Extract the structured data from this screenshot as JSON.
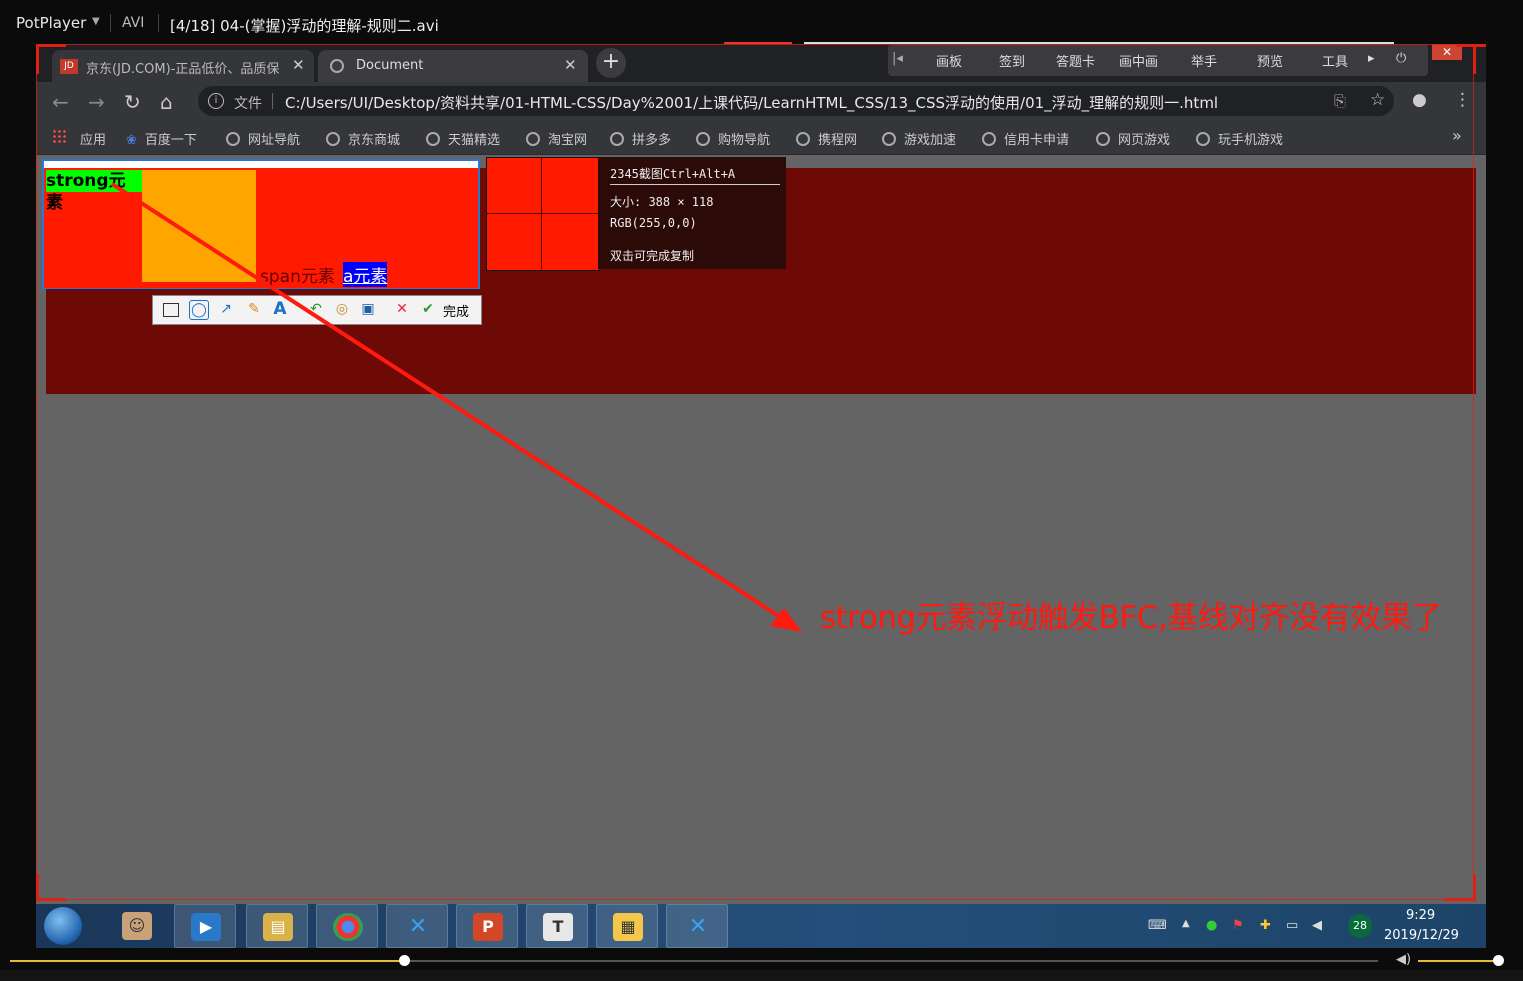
{
  "player": {
    "brand": "PotPlayer",
    "format": "AVI",
    "file_title": "[4/18] 04-(掌握)浮动的理解-规则二.avi",
    "seek_progress_pct": 29,
    "volume_pct": 95
  },
  "browser": {
    "tabs": [
      {
        "favicon": "JD",
        "title": "京东(JD.COM)-正品低价、品质保",
        "close": "✕"
      },
      {
        "title": "Document",
        "close": "✕"
      }
    ],
    "new_tab": "+",
    "address_label": "文件",
    "url": "C:/Users/UI/Desktop/资料共享/01-HTML-CSS/Day%2001/上课代码/LearnHTML_CSS/13_CSS浮动的使用/01_浮动_理解的规则一.html",
    "bookmarks": [
      "应用",
      "百度一下",
      "网址导航",
      "京东商城",
      "天猫精选",
      "淘宝网",
      "拼多多",
      "购物导航",
      "携程网",
      "游戏加速",
      "信用卡申请",
      "网页游戏",
      "玩手机游戏"
    ],
    "bookmarks_more": "»"
  },
  "qq_toolbar": {
    "items": [
      "画板",
      "签到",
      "答题卡",
      "画中画",
      "举手",
      "预览",
      "工具"
    ]
  },
  "page": {
    "strong_text": "strong元素",
    "span_text": "span元素",
    "a_text": "a元素"
  },
  "screenshot_tool": {
    "title": "2345截图Ctrl+Alt+A",
    "size": "大小: 388 × 118",
    "rgb": "RGB(255,0,0)",
    "hint": "双击可完成复制",
    "done_label": "完成"
  },
  "annotation": "strong元素浮动触发BFC,基线对齐没有效果了",
  "taskbar": {
    "time": "9:29",
    "date": "2019/12/29",
    "badge": "28"
  },
  "colors": {
    "accent_red": "#ff1a00",
    "dark_red": "#6e0a05",
    "green": "#00ff00",
    "orange": "#ffa500",
    "link_blue": "#0000ff",
    "seek_yellow": "#e8b93a"
  }
}
